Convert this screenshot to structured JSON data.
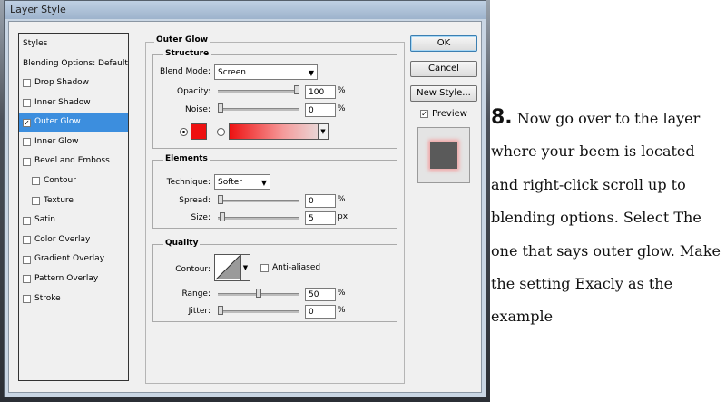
{
  "window": {
    "title": "Layer Style"
  },
  "styles_panel": {
    "header": "Styles",
    "items": [
      {
        "label": "Blending Options: Default",
        "checkbox": false,
        "checked": false,
        "sub": false,
        "active": false
      },
      {
        "label": "Drop Shadow",
        "checkbox": true,
        "checked": false,
        "sub": false,
        "active": false
      },
      {
        "label": "Inner Shadow",
        "checkbox": true,
        "checked": false,
        "sub": false,
        "active": false
      },
      {
        "label": "Outer Glow",
        "checkbox": true,
        "checked": true,
        "sub": false,
        "active": true
      },
      {
        "label": "Inner Glow",
        "checkbox": true,
        "checked": false,
        "sub": false,
        "active": false
      },
      {
        "label": "Bevel and Emboss",
        "checkbox": true,
        "checked": false,
        "sub": false,
        "active": false
      },
      {
        "label": "Contour",
        "checkbox": true,
        "checked": false,
        "sub": true,
        "active": false
      },
      {
        "label": "Texture",
        "checkbox": true,
        "checked": false,
        "sub": true,
        "active": false
      },
      {
        "label": "Satin",
        "checkbox": true,
        "checked": false,
        "sub": false,
        "active": false
      },
      {
        "label": "Color Overlay",
        "checkbox": true,
        "checked": false,
        "sub": false,
        "active": false
      },
      {
        "label": "Gradient Overlay",
        "checkbox": true,
        "checked": false,
        "sub": false,
        "active": false
      },
      {
        "label": "Pattern Overlay",
        "checkbox": true,
        "checked": false,
        "sub": false,
        "active": false
      },
      {
        "label": "Stroke",
        "checkbox": true,
        "checked": false,
        "sub": false,
        "active": false
      }
    ]
  },
  "outer_glow": {
    "title": "Outer Glow",
    "structure": {
      "title": "Structure",
      "blend_mode_label": "Blend Mode:",
      "blend_mode": "Screen",
      "opacity_label": "Opacity:",
      "opacity": "100",
      "opacity_frac": 1.0,
      "noise_label": "Noise:",
      "noise": "0",
      "noise_frac": 0,
      "percent": "%",
      "color": "#ee1111"
    },
    "elements": {
      "title": "Elements",
      "technique_label": "Technique:",
      "technique": "Softer",
      "spread_label": "Spread:",
      "spread": "0",
      "spread_frac": 0,
      "size_label": "Size:",
      "size": "5",
      "size_frac": 0.02,
      "percent": "%",
      "px": "px"
    },
    "quality": {
      "title": "Quality",
      "contour_label": "Contour:",
      "anti_aliased_label": "Anti-aliased",
      "range_label": "Range:",
      "range": "50",
      "range_frac": 0.5,
      "jitter_label": "Jitter:",
      "jitter": "0",
      "jitter_frac": 0,
      "percent": "%"
    }
  },
  "buttons": {
    "ok": "OK",
    "cancel": "Cancel",
    "new_style": "New Style...",
    "preview": "Preview",
    "preview_checked": true
  },
  "caption": {
    "step": "8.",
    "text": "Now go over to the layer where your beem is located and right-click scroll up to blending options. Select The one that says outer glow. Make the setting Exacly as the example"
  }
}
